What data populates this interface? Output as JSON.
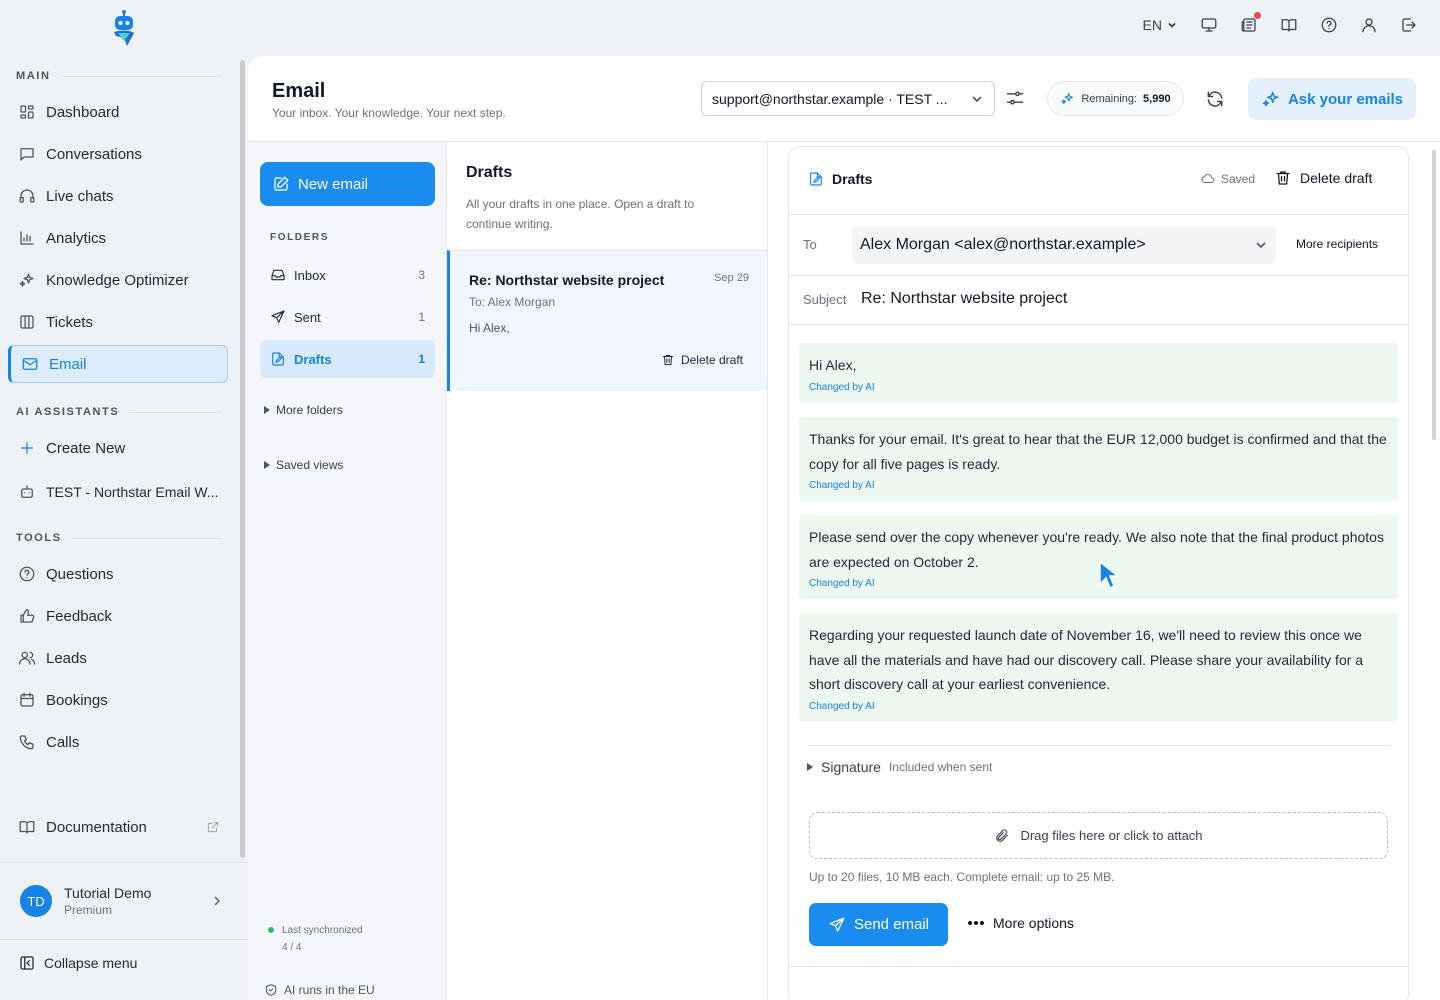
{
  "topbar": {
    "language": "EN"
  },
  "sidebar": {
    "sections": {
      "main": "MAIN",
      "ai": "AI ASSISTANTS",
      "tools": "TOOLS"
    },
    "main_items": [
      {
        "label": "Dashboard",
        "icon": "dashboard-icon"
      },
      {
        "label": "Conversations",
        "icon": "chat-icon"
      },
      {
        "label": "Live chats",
        "icon": "headset-icon"
      },
      {
        "label": "Analytics",
        "icon": "chart-icon"
      },
      {
        "label": "Knowledge Optimizer",
        "icon": "sparkles-icon"
      },
      {
        "label": "Tickets",
        "icon": "columns-icon"
      },
      {
        "label": "Email",
        "icon": "mail-icon",
        "active": true
      }
    ],
    "ai_items": [
      {
        "label": "Create New",
        "icon": "plus-icon"
      },
      {
        "label": "TEST - Northstar Email W...",
        "icon": "bot-icon"
      }
    ],
    "tool_items": [
      {
        "label": "Questions",
        "icon": "question-icon"
      },
      {
        "label": "Feedback",
        "icon": "thumbs-up-icon"
      },
      {
        "label": "Leads",
        "icon": "users-icon"
      },
      {
        "label": "Bookings",
        "icon": "calendar-icon"
      },
      {
        "label": "Calls",
        "icon": "phone-icon"
      }
    ],
    "documentation": "Documentation",
    "user": {
      "initials": "TD",
      "name": "Tutorial Demo",
      "plan": "Premium"
    },
    "collapse": "Collapse menu"
  },
  "header": {
    "title": "Email",
    "subtitle": "Your inbox. Your knowledge. Your next step.",
    "account": "support@northstar.example · TEST ...",
    "remaining_label": "Remaining:",
    "remaining_value": "5,990",
    "ask_button": "Ask your emails"
  },
  "folders": {
    "new_email": "New email",
    "label": "FOLDERS",
    "items": [
      {
        "label": "Inbox",
        "count": "3"
      },
      {
        "label": "Sent",
        "count": "1"
      },
      {
        "label": "Drafts",
        "count": "1",
        "active": true
      }
    ],
    "more_folders": "More folders",
    "saved_views": "Saved views",
    "sync_label": "Last synchronized",
    "sync_count": "4 / 4",
    "ai_eu": "AI runs in the EU"
  },
  "list": {
    "title": "Drafts",
    "description": "All your drafts in one place. Open a draft to continue writing.",
    "draft": {
      "subject": "Re: Northstar website project",
      "date": "Sep 29",
      "to": "To: Alex Morgan",
      "preview": "Hi Alex,",
      "delete": "Delete draft"
    }
  },
  "editor": {
    "title": "Drafts",
    "saved": "Saved",
    "delete": "Delete draft",
    "to_label": "To",
    "to_value": "Alex Morgan <alex@northstar.example>",
    "more_recipients": "More recipients",
    "subject_label": "Subject",
    "subject_value": "Re: Northstar website project",
    "paragraphs": [
      {
        "text": "Hi Alex,",
        "tag": "Changed by AI"
      },
      {
        "text": "Thanks for your email. It's great to hear that the EUR 12,000 budget is confirmed and that the copy for all five pages is ready.",
        "tag": "Changed by AI"
      },
      {
        "text": "Please send over the copy whenever you're ready. We also note that the final product photos are expected on October 2.",
        "tag": "Changed by AI"
      },
      {
        "text": "Regarding your requested launch date of November 16, we'll need to review this once we have all the materials and have had our discovery call. Please share your availability for a short discovery call at your earliest convenience.",
        "tag": "Changed by AI"
      }
    ],
    "signature_label": "Signature",
    "signature_note": "Included when sent",
    "attach": "Drag files here or click to attach",
    "attach_note": "Up to 20 files, 10 MB each. Complete email: up to 25 MB.",
    "send": "Send email",
    "more_options": "More options"
  },
  "colors": {
    "accent": "#1683e6",
    "ai_highlight": "#edf8f1",
    "sidebar_bg": "#eef1f5"
  }
}
